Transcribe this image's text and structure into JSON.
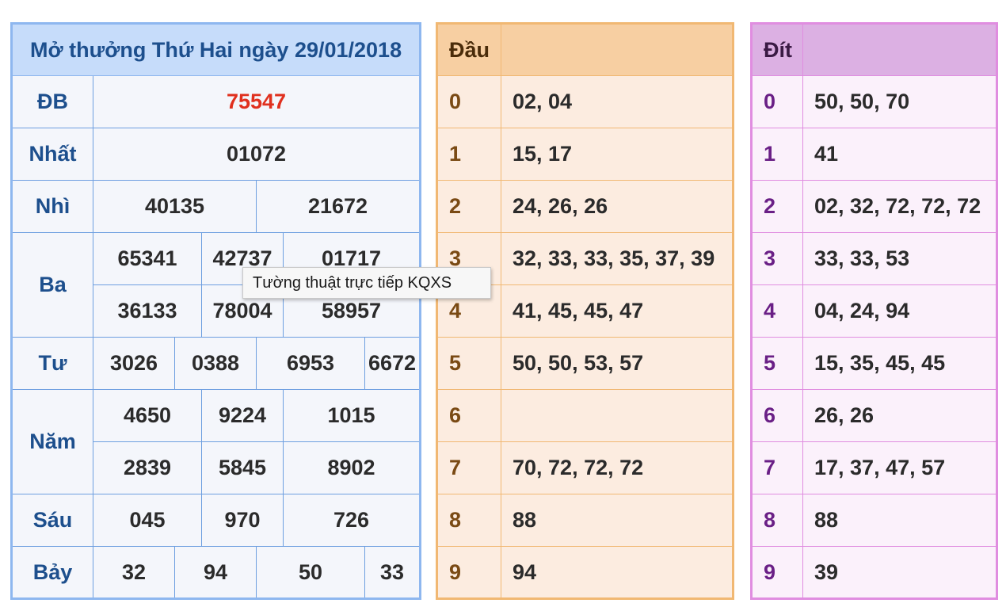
{
  "result": {
    "title": "Mở thưởng Thứ Hai ngày 29/01/2018",
    "prizes": {
      "db": {
        "label": "ĐB",
        "numbers": [
          "75547"
        ]
      },
      "nhat": {
        "label": "Nhất",
        "numbers": [
          "01072"
        ]
      },
      "nhi": {
        "label": "Nhì",
        "numbers": [
          "40135",
          "21672"
        ]
      },
      "ba": {
        "label": "Ba",
        "numbers": [
          "65341",
          "42737",
          "01717",
          "36133",
          "78004",
          "58957"
        ]
      },
      "tu": {
        "label": "Tư",
        "numbers": [
          "3026",
          "0388",
          "6953",
          "6672"
        ]
      },
      "nam": {
        "label": "Năm",
        "numbers": [
          "4650",
          "9224",
          "1015",
          "2839",
          "5845",
          "8902"
        ]
      },
      "sau": {
        "label": "Sáu",
        "numbers": [
          "045",
          "970",
          "726"
        ]
      },
      "bay": {
        "label": "Bảy",
        "numbers": [
          "32",
          "94",
          "50",
          "33"
        ]
      }
    }
  },
  "dau": {
    "header": "Đầu",
    "rows": [
      {
        "digit": "0",
        "values": "02, 04"
      },
      {
        "digit": "1",
        "values": "15, 17"
      },
      {
        "digit": "2",
        "values": "24, 26, 26"
      },
      {
        "digit": "3",
        "values": "32, 33, 33, 35, 37, 39"
      },
      {
        "digit": "4",
        "values": "41, 45, 45, 47"
      },
      {
        "digit": "5",
        "values": "50, 50, 53, 57"
      },
      {
        "digit": "6",
        "values": ""
      },
      {
        "digit": "7",
        "values": "70, 72, 72, 72"
      },
      {
        "digit": "8",
        "values": "88"
      },
      {
        "digit": "9",
        "values": "94"
      }
    ]
  },
  "dit": {
    "header": "Đít",
    "rows": [
      {
        "digit": "0",
        "values": "50, 50, 70"
      },
      {
        "digit": "1",
        "values": "41"
      },
      {
        "digit": "2",
        "values": "02, 32, 72, 72, 72"
      },
      {
        "digit": "3",
        "values": "33, 33, 53"
      },
      {
        "digit": "4",
        "values": "04, 24, 94"
      },
      {
        "digit": "5",
        "values": "15, 35, 45, 45"
      },
      {
        "digit": "6",
        "values": "26, 26"
      },
      {
        "digit": "7",
        "values": "17, 37, 47, 57"
      },
      {
        "digit": "8",
        "values": "88"
      },
      {
        "digit": "9",
        "values": "39"
      }
    ]
  },
  "tooltip": {
    "text": "Tường thuật trực tiếp KQXS"
  },
  "colors": {
    "special_prize": "#e0301e",
    "result_accent": "#1d4f8d",
    "dau_accent": "#f1b873",
    "dit_accent": "#e08de0"
  }
}
